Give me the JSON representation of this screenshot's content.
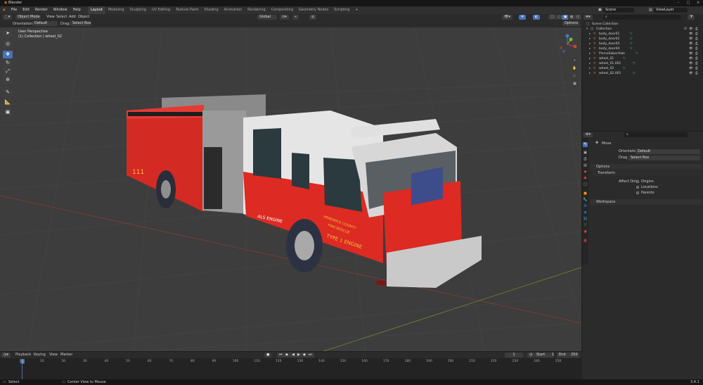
{
  "window": {
    "title": "Blender"
  },
  "menu": [
    "File",
    "Edit",
    "Render",
    "Window",
    "Help"
  ],
  "workspaces": [
    "Layout",
    "Modeling",
    "Sculpting",
    "UV Editing",
    "Texture Paint",
    "Shading",
    "Animation",
    "Rendering",
    "Compositing",
    "Geometry Nodes",
    "Scripting",
    "+"
  ],
  "active_workspace": "Layout",
  "scene": {
    "name": "Scene",
    "view_layer": "ViewLayer"
  },
  "header": {
    "mode": "Object Mode",
    "view": "View",
    "select": "Select",
    "add": "Add",
    "object": "Object",
    "transform_orientation": "Global"
  },
  "tool_settings": {
    "orientation_label": "Orientation:",
    "orientation_value": "Default",
    "drag_label": "Drag:",
    "drag_value": "Select Box",
    "options": "Options"
  },
  "viewport": {
    "perspective": "User Perspective",
    "collection_info": "(1) Collection | wheel_02"
  },
  "outliner": {
    "scene_collection": "Scene Collection",
    "collection": "Collection",
    "items": [
      "body_door01",
      "body_door02",
      "body_door03",
      "body_door04",
      "PierceSaberHale",
      "wheel_01",
      "wheel_01.001",
      "wheel_02",
      "wheel_02.001"
    ]
  },
  "properties": {
    "tool_name": "Move",
    "orientation_label": "Orientation",
    "orientation_value": "Default",
    "drag_label": "Drag",
    "drag_value": "Select Box",
    "options_header": "Options",
    "transform_header": "Transform",
    "affect_only_label": "Affect Only",
    "affect_only": [
      "Origins",
      "Locations",
      "Parents"
    ],
    "workspace_header": "Workspace"
  },
  "timeline": {
    "menus": [
      "Playback",
      "Keying",
      "View",
      "Marker"
    ],
    "current_frame": "1",
    "start_label": "Start",
    "start": "1",
    "end_label": "End",
    "end": "250",
    "ticks": [
      "0",
      "10",
      "20",
      "30",
      "40",
      "50",
      "60",
      "70",
      "80",
      "90",
      "100",
      "110",
      "120",
      "130",
      "140",
      "150",
      "160",
      "170",
      "180",
      "190",
      "200",
      "210",
      "220",
      "230",
      "240",
      "250"
    ],
    "playhead_frame": "1"
  },
  "status": {
    "select": "Select",
    "center": "Center View to Mouse",
    "version": "3.4.1"
  },
  "truck": {
    "unit_number": "111",
    "side_text": "ALS ENGINE",
    "door_text_1": "HENDRICK COUNTY",
    "door_text_2": "FIRE-RESCUE",
    "door_text_3": "TYPE 1 ENGINE"
  },
  "colors": {
    "accent": "#4772b3",
    "truck_red": "#e0241d",
    "truck_white": "#e8e8e8",
    "viewport_bg": "#3d3d3d",
    "grid_line": "#474747"
  }
}
